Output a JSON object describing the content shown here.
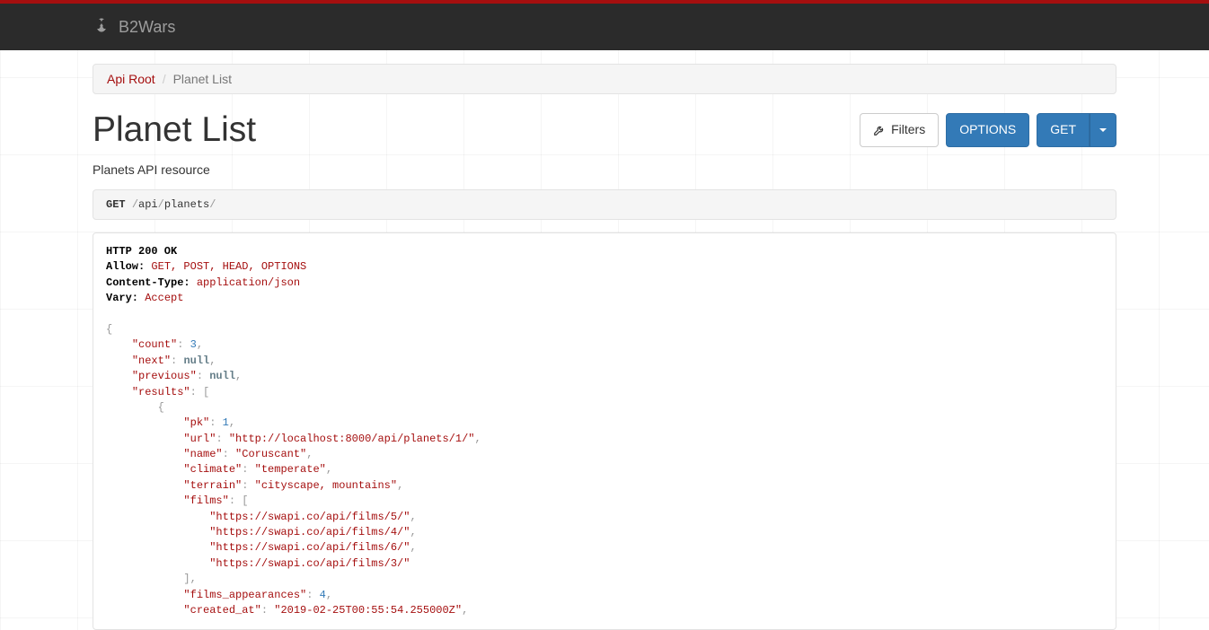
{
  "brand": "B2Wars",
  "breadcrumb": {
    "root": "Api Root",
    "current": "Planet List"
  },
  "page": {
    "title": "Planet List",
    "description": "Planets API resource"
  },
  "actions": {
    "filters": "Filters",
    "options": "OPTIONS",
    "get": "GET"
  },
  "request": {
    "method": "GET",
    "seg1": "api",
    "seg2": "planets"
  },
  "response": {
    "status": "HTTP 200 OK",
    "allow_label": "Allow:",
    "allow_value": "GET, POST, HEAD, OPTIONS",
    "ctype_label": "Content-Type:",
    "ctype_value": "application/json",
    "vary_label": "Vary:",
    "vary_value": "Accept"
  },
  "body": {
    "count": 3,
    "next": "null",
    "previous": "null",
    "result0": {
      "pk": 1,
      "url": "\"http://localhost:8000/api/planets/1/\"",
      "name": "\"Coruscant\"",
      "climate": "\"temperate\"",
      "terrain": "\"cityscape, mountains\"",
      "films0": "\"https://swapi.co/api/films/5/\"",
      "films1": "\"https://swapi.co/api/films/4/\"",
      "films2": "\"https://swapi.co/api/films/6/\"",
      "films3": "\"https://swapi.co/api/films/3/\"",
      "films_appearances": 4,
      "created_at": "\"2019-02-25T00:55:54.255000Z\""
    }
  }
}
